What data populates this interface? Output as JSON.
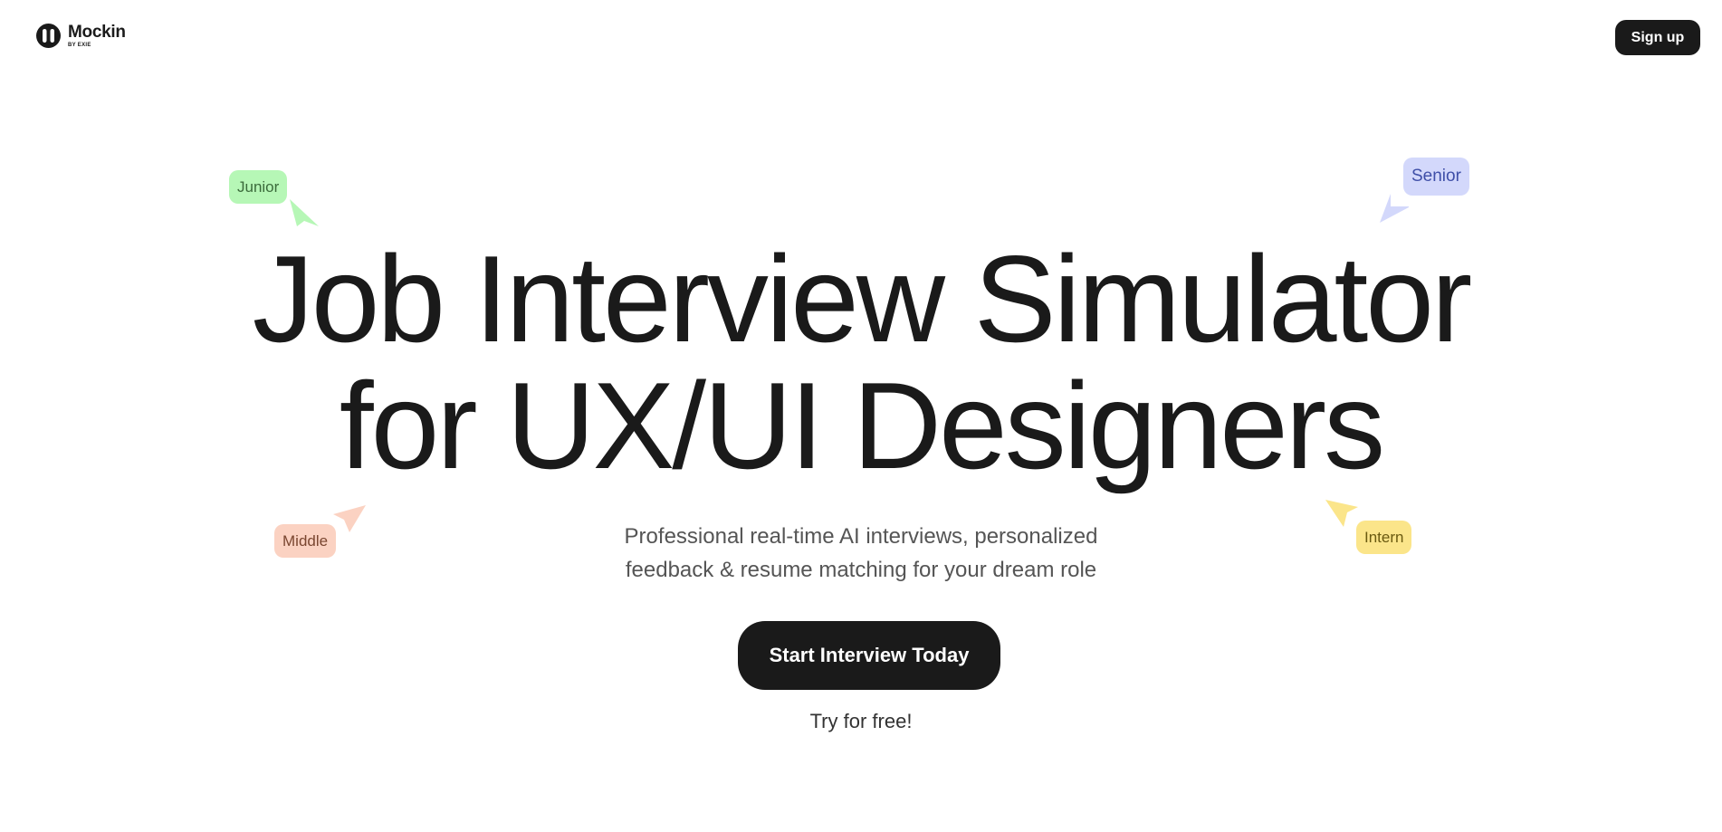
{
  "header": {
    "logo_name": "Mockin",
    "logo_sub": "BY EXIE",
    "signup_label": "Sign up"
  },
  "hero": {
    "title_line1": "Job Interview Simulator",
    "title_line2": "for UX/UI Designers",
    "subtitle_line1": "Professional real-time AI interviews, personalized",
    "subtitle_line2": "feedback & resume matching for your dream role",
    "cta_label": "Start Interview Today",
    "cta_note": "Try for free!"
  },
  "tags": {
    "junior": "Junior",
    "senior": "Senior",
    "middle": "Middle",
    "intern": "Intern"
  },
  "colors": {
    "brand_dark": "#1a1a1a",
    "junior": "#b6f7b6",
    "senior": "#d3d8fb",
    "middle": "#fbd2c2",
    "intern": "#fbe58a"
  }
}
